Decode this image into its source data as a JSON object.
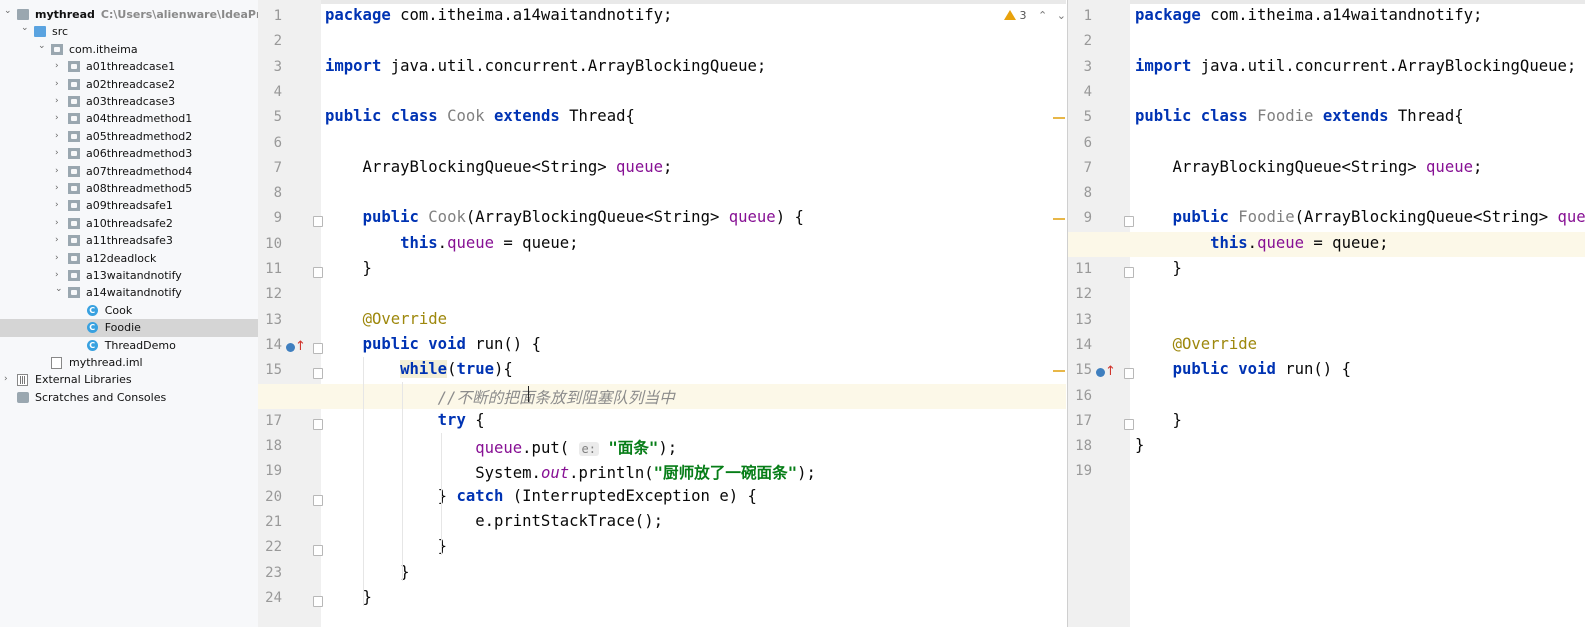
{
  "project_tree": {
    "root": {
      "label": "mythread",
      "path": "C:\\Users\\alienware\\IdeaProjects\\"
    },
    "src": "src",
    "package": "com.itheima",
    "subpackages": [
      "a01threadcase1",
      "a02threadcase2",
      "a03threadcase3",
      "a04threadmethod1",
      "a05threadmethod2",
      "a06threadmethod3",
      "a07threadmethod4",
      "a08threadmethod5",
      "a09threadsafe1",
      "a10threadsafe2",
      "a11threadsafe3",
      "a12deadlock",
      "a13waitandnotify",
      "a14waitandnotify"
    ],
    "classes": [
      "Cook",
      "Foodie",
      "ThreadDemo"
    ],
    "selected_class": "Foodie",
    "iml_file": "mythread.iml",
    "external_libraries": "External Libraries",
    "scratches": "Scratches and Consoles"
  },
  "editor_left": {
    "file": "Cook",
    "warnings_count": "3",
    "highlighted_line": 16,
    "lines": [
      "package com.itheima.a14waitandnotify;",
      "",
      "import java.util.concurrent.ArrayBlockingQueue;",
      "",
      "public class Cook extends Thread{",
      "",
      "    ArrayBlockingQueue<String> queue;",
      "",
      "    public Cook(ArrayBlockingQueue<String> queue) {",
      "        this.queue = queue;",
      "    }",
      "",
      "    @Override",
      "    public void run() {",
      "        while(true){",
      "            //不断的把面条放到阻塞队列当中",
      "            try {",
      "                queue.put( e: \"面条\");",
      "                System.out.println(\"厨师放了一碗面条\");",
      "            } catch (InterruptedException e) {",
      "                e.printStackTrace();",
      "            }",
      "        }",
      "    }"
    ]
  },
  "editor_right": {
    "file": "Foodie",
    "highlighted_line": 10,
    "lines": [
      "package com.itheima.a14waitandnotify;",
      "",
      "import java.util.concurrent.ArrayBlockingQueue;",
      "",
      "public class Foodie extends Thread{",
      "",
      "    ArrayBlockingQueue<String> queue;",
      "",
      "    public Foodie(ArrayBlockingQueue<String> queue) {",
      "        this.queue = queue;",
      "    }",
      "",
      "",
      "    @Override",
      "    public void run() {",
      "",
      "    }",
      "}",
      ""
    ]
  }
}
